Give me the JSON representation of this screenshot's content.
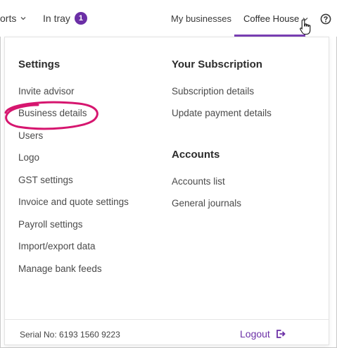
{
  "topbar": {
    "reports_label": "orts",
    "intray_label": "In tray",
    "intray_count": "1",
    "my_businesses_label": "My businesses",
    "business_label": "Coffee House",
    "help_icon": "question-circle-icon"
  },
  "settings": {
    "heading": "Settings",
    "items": [
      "Invite advisor",
      "Business details",
      "Users",
      "Logo",
      "GST settings",
      "Invoice and quote settings",
      "Payroll settings",
      "Import/export data",
      "Manage bank feeds"
    ]
  },
  "subscription": {
    "heading": "Your Subscription",
    "items": [
      "Subscription details",
      "Update payment details"
    ]
  },
  "accounts": {
    "heading": "Accounts",
    "items": [
      "Accounts list",
      "General journals"
    ]
  },
  "footer": {
    "serial": "Serial No: 6193 1560 9223",
    "logout_label": "Logout"
  },
  "colors": {
    "accent": "#6b2fa6",
    "annotation": "#d6166f"
  }
}
